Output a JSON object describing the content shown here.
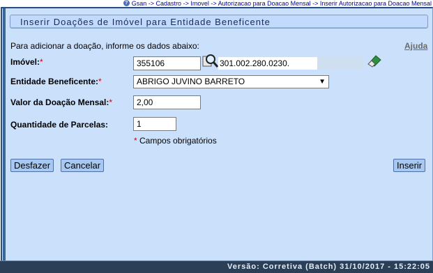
{
  "breadcrumb": {
    "help_icon": "info-icon",
    "text": "Gsan -> Cadastro -> Imovel -> Autorizacao para Doacao Mensal -> Inserir Autorizacao para Doacao Mensal"
  },
  "form": {
    "title": "Inserir Doações de Imóvel para Entidade Beneficente",
    "intro": "Para adicionar a doação, informe os dados abaixo:",
    "help_link": "Ajuda",
    "required_mark": "*",
    "imovel": {
      "label": "Imóvel:",
      "value": "355106",
      "description": "301.002.280.0230.",
      "search_icon": "search-magnifier-icon",
      "clear_icon": "eraser-icon"
    },
    "entidade": {
      "label": "Entidade Beneficente:",
      "selected": "ABRIGO JUVINO BARRETO"
    },
    "valor": {
      "label": "Valor da Doação Mensal:",
      "value": "2,00"
    },
    "parcelas": {
      "label": "Quantidade de Parcelas:",
      "value": "1"
    },
    "required_note": "Campos obrigatórios"
  },
  "buttons": {
    "undo": "Desfazer",
    "cancel": "Cancelar",
    "insert": "Inserir"
  },
  "footer": {
    "version": "Versão: Corretiva (Batch) 31/10/2017 - 15:22:05"
  },
  "colors": {
    "panel_bg": "#cbe0fb",
    "title_bg": "#c2dafb",
    "button_bg": "#a9c8ef",
    "footer_bg": "#2b3f57",
    "required": "#cc0000"
  }
}
